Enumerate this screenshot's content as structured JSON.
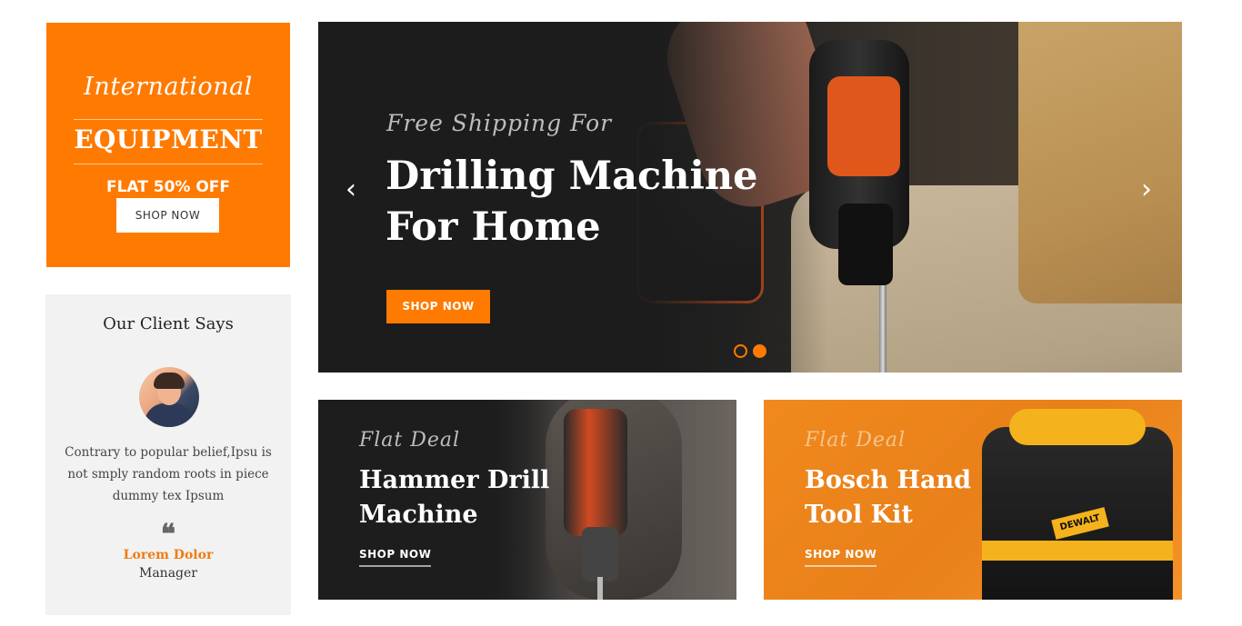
{
  "promo": {
    "script_title": "International",
    "title": "EQUIPMENT",
    "offer": "FLAT 50% OFF",
    "button_label": "SHOP NOW",
    "color": "#ff7a00"
  },
  "testimonial": {
    "heading": "Our Client Says",
    "text": "Contrary to popular belief,Ipsu is not smply random roots in piece dummy tex Ipsum",
    "quote_icon": "quote-icon",
    "name": "Lorem Dolor",
    "role": "Manager"
  },
  "hero": {
    "eyebrow": "Free Shipping For",
    "title_line1": "Drilling Machine",
    "title_line2": "For Home",
    "button_label": "SHOP NOW",
    "prev_icon": "chevron-left-icon",
    "next_icon": "chevron-right-icon",
    "prev_glyph": "‹",
    "next_glyph": "›",
    "slides_total": 2,
    "active_slide": 2
  },
  "banners": [
    {
      "eyebrow": "Flat Deal",
      "title_line1": "Hammer Drill",
      "title_line2": "Machine",
      "link_label": "SHOP NOW"
    },
    {
      "eyebrow": "Flat Deal",
      "title_line1": "Bosch Hand",
      "title_line2": "Tool Kit",
      "link_label": "SHOP NOW",
      "product_label": "DEWALT"
    }
  ],
  "colors": {
    "accent": "#ff7a00",
    "name_accent": "#f07c10"
  }
}
